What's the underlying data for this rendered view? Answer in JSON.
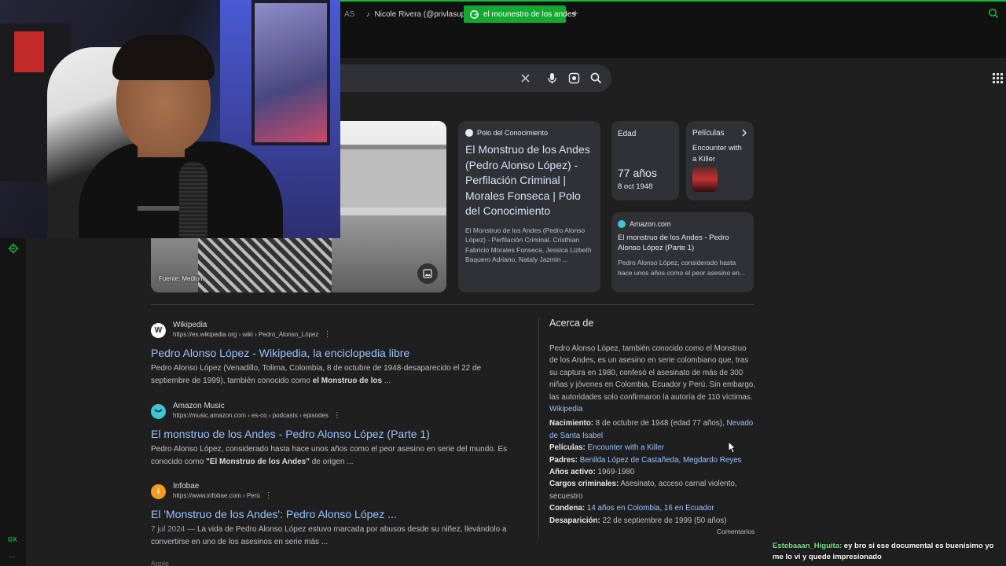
{
  "browser": {
    "tabs": [
      {
        "label": "AS"
      },
      {
        "label": "Nicole Rivera (@privlasup",
        "icon": "tiktok-icon"
      },
      {
        "label": "el mounestro de los andes",
        "icon": "google-icon",
        "active": true
      }
    ],
    "new_tab_label": "+",
    "accent_color": "#18b93b"
  },
  "image_panel": {
    "source_caption": "Fuente: Medium"
  },
  "top_card": {
    "source": "Polo del Conocimiento",
    "title": "El Monstruo de los Andes (Pedro Alonso López) - Perfilación Criminal | Morales Fonseca | Polo del Conocimiento",
    "snippet": "El Monstruo de los Andes (Pedro Alonso López) - Perfilación Criminal. Cristhian Fabricio Morales Fonseca, Jessica Lizbeth Baquero Adriano, Nataly Jazmin ..."
  },
  "age_card": {
    "label": "Edad",
    "value": "77 años",
    "date": "8 oct 1948"
  },
  "movies_card": {
    "label": "Películas",
    "movie": "Encounter with a Killer"
  },
  "amazon_card": {
    "source": "Amazon.com",
    "title": "El monstruo de los Andes - Pedro Alonso López (Parte 1)",
    "snippet": "Pedro Alonso López, considerado hasta hace unos años como el peor asesino en..."
  },
  "results": [
    {
      "site": "Wikipedia",
      "url": "https://es.wikipedia.org › wiki › Pedro_Alonso_López",
      "title": "Pedro Alonso López - Wikipedia, la enciclopedia libre",
      "snippet_a": "Pedro Alonso López (Venadillo, Tolima, Colombia, 8 de octubre de 1948-desaparecido el 22 de septiembre de 1999), también conocido como ",
      "snippet_bold": "el Monstruo de los",
      "snippet_b": " ..."
    },
    {
      "site": "Amazon Music",
      "url": "https://music.amazon.com › es-co › podcasts › episodes",
      "title": "El monstruo de los Andes - Pedro Alonso López (Parte 1)",
      "snippet_a": "Pedro Alonso López, considerado hasta hace unos años como el peor asesino en serie del mundo. Es conocido como ",
      "snippet_bold": "\"El Monstruo de los Andes\"",
      "snippet_b": " de origen ..."
    },
    {
      "site": "Infobae",
      "url": "https://www.infobae.com › Perú",
      "title": "El 'Monstruo de los Andes': Pedro Alonso López ...",
      "date": "7 jul 2024 — ",
      "snippet_a": "La vida de Pedro Alonso López estuvo marcada por abusos desde su niñez, llevándolo a convertirse en uno de los asesinos en serie más ..."
    }
  ],
  "next_result_peek": "Apple",
  "knowledge_panel": {
    "title": "Acerca de",
    "description": "Pedro Alonso López, también conocido como el Monstruo de los Andes,  es un asesino en serie colombiano que, tras su captura en 1980, confesó el asesinato de más de 300 niñas y jóvenes en Colombia, Ecuador y Perú. Sin embargo, las autoridades solo confirmaron la autoría de 110 víctimas. ",
    "description_link": "Wikipedia",
    "facts": {
      "birth_label": "Nacimiento:",
      "birth_value": " 8 de octubre de 1948 (edad 77 años), ",
      "birth_link": "Nevado de Santa Isabel",
      "movies_label": "Películas:",
      "movies_link": "Encounter with a Killer",
      "parents_label": "Padres:",
      "parents_link": "Benilda López de Castañeda, Megdardo Reyes",
      "active_label": "Años activo:",
      "active_value": " 1969-1980",
      "charges_label": "Cargos criminales:",
      "charges_value": " Asesinato, acceso carnal violento, secuestro",
      "sentence_label": "Condena:",
      "sentence_link": "14 años en Colombia, 16 en Ecuador",
      "disappear_label": "Desaparición:",
      "disappear_value": " 22 de septiembre de 1999 (50 años)"
    },
    "comments": "Comentarios"
  },
  "sidebar": {
    "gx_label": "GX",
    "more_label": "..."
  },
  "chat": {
    "user": "Estebaaan_Higuita:",
    "message": " ey bro si ese documental es buenisimo yo me lo vi y quede impresionado"
  }
}
